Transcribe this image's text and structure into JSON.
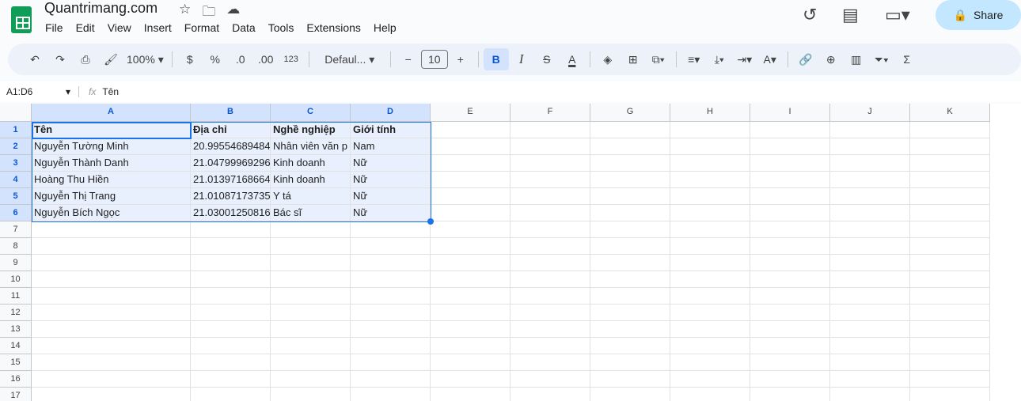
{
  "app": {
    "title": "Quantrimang.com",
    "share_label": "Share",
    "menu": [
      "File",
      "Edit",
      "View",
      "Insert",
      "Format",
      "Data",
      "Tools",
      "Extensions",
      "Help"
    ]
  },
  "toolbar": {
    "zoom": "100%",
    "currency": "$",
    "percent": "%",
    "dec_decrease": ".0",
    "dec_increase": ".00",
    "number_format": "123",
    "font": "Defaul...",
    "font_size": "10",
    "bold": "B",
    "italic": "I"
  },
  "formula_bar": {
    "name_box": "A1:D6",
    "fx": "fx",
    "content": "Tên"
  },
  "sheet": {
    "columns": [
      "A",
      "B",
      "C",
      "D",
      "E",
      "F",
      "G",
      "H",
      "I",
      "J",
      "K"
    ],
    "row_count": 17,
    "rows": [
      [
        "Tên",
        "Địa chỉ",
        "Nghề nghiệp",
        "Giới tính"
      ],
      [
        "Nguyễn Tường Minh",
        "20.99554689484",
        "Nhân viên văn p",
        "Nam"
      ],
      [
        "Nguyễn Thành Danh",
        "21.04799969296",
        "Kinh doanh",
        "Nữ"
      ],
      [
        "Hoàng Thu Hiền",
        "21.01397168664",
        "Kinh doanh",
        "Nữ"
      ],
      [
        "Nguyễn Thị Trang",
        "21.01087173735",
        "Y tá",
        "Nữ"
      ],
      [
        "Nguyễn Bích Ngọc",
        "21.03001250816",
        "Bác sĩ",
        "Nữ"
      ]
    ],
    "selection": "A1:D6"
  },
  "colors": {
    "accent": "#1a73e8",
    "selection_fill": "#e8f0fe",
    "share_bg": "#c2e7ff"
  }
}
